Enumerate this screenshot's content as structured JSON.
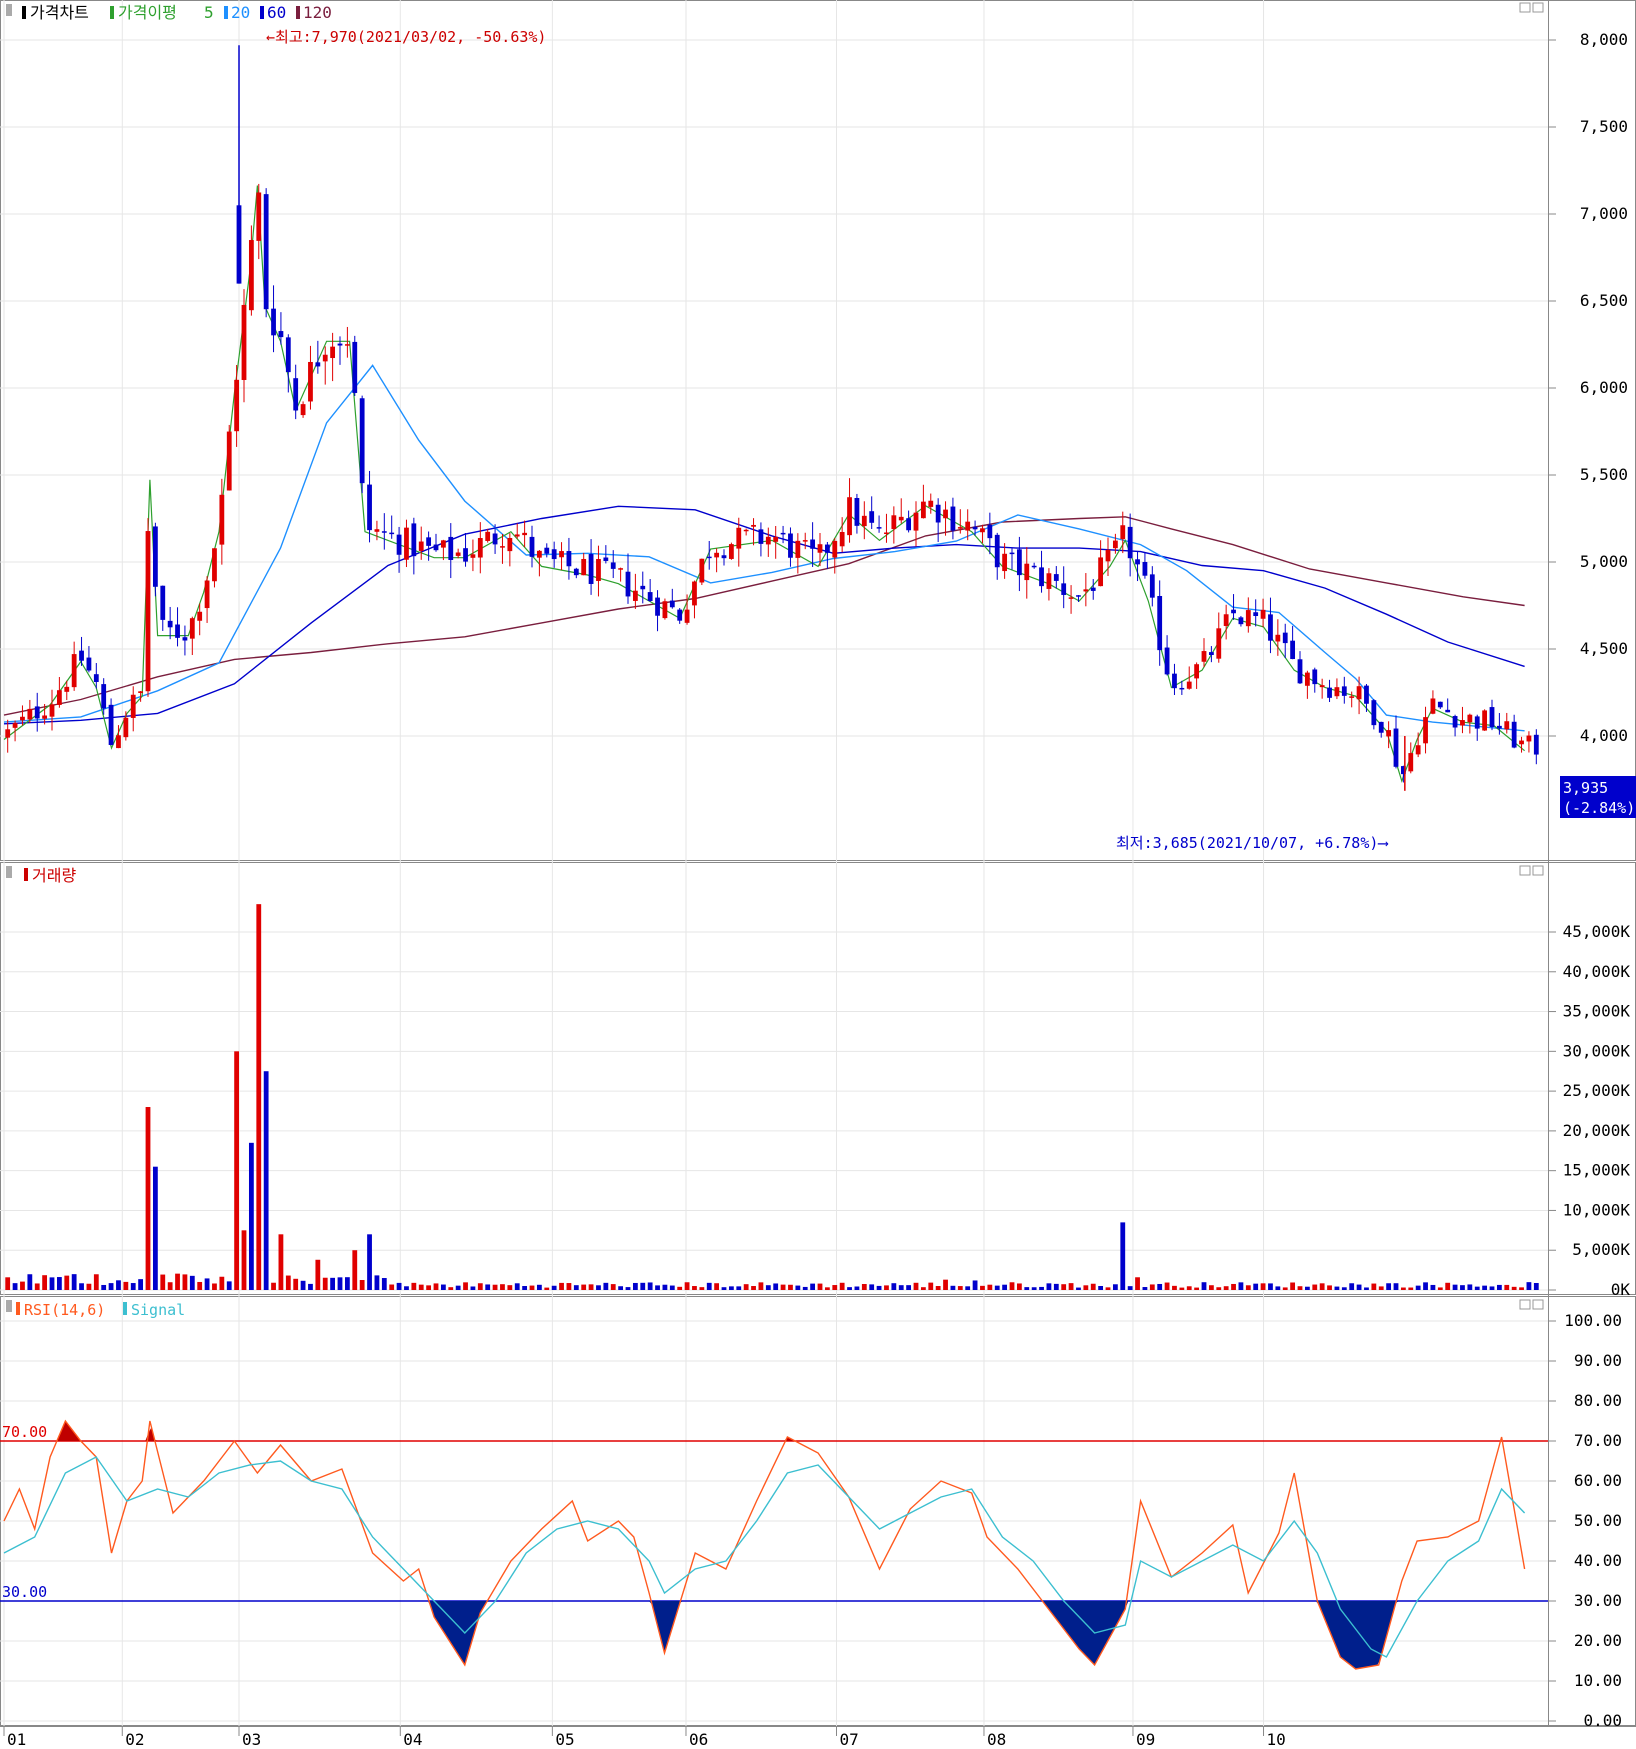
{
  "chart_data": [
    {
      "type": "candlestick",
      "panel": "price",
      "legend": [
        {
          "label": "가격차트",
          "color": "#000000"
        },
        {
          "label": "가격이평",
          "color": "#2ea02e"
        },
        {
          "label": "5",
          "color": "#2ea02e"
        },
        {
          "label": "20",
          "color": "#1e90ff"
        },
        {
          "label": "60",
          "color": "#0000cc"
        },
        {
          "label": "120",
          "color": "#7a1e3e"
        }
      ],
      "y_ticks": [
        "8,000",
        "7,500",
        "7,000",
        "6,500",
        "6,000",
        "5,500",
        "5,000",
        "4,500",
        "4,000"
      ],
      "ylim": [
        3550,
        8100
      ],
      "x_ticks": [
        "01",
        "02",
        "03",
        "04",
        "05",
        "06",
        "07",
        "08",
        "09",
        "10"
      ],
      "max_annotation": "←최고:7,970(2021/03/02, -50.63%)",
      "min_annotation": "최저:3,685(2021/10/07, +6.78%)⟶",
      "last_price": "3,935",
      "last_change": "(-2.84%)",
      "ma20_approx": [
        [
          0,
          4080
        ],
        [
          0.05,
          4110
        ],
        [
          0.1,
          4260
        ],
        [
          0.14,
          4420
        ],
        [
          0.18,
          5080
        ],
        [
          0.21,
          5800
        ],
        [
          0.24,
          6130
        ],
        [
          0.27,
          5700
        ],
        [
          0.3,
          5350
        ],
        [
          0.34,
          5040
        ],
        [
          0.38,
          5050
        ],
        [
          0.42,
          5030
        ],
        [
          0.46,
          4880
        ],
        [
          0.5,
          4940
        ],
        [
          0.54,
          5020
        ],
        [
          0.58,
          5060
        ],
        [
          0.62,
          5120
        ],
        [
          0.66,
          5270
        ],
        [
          0.7,
          5190
        ],
        [
          0.74,
          5100
        ],
        [
          0.77,
          4950
        ],
        [
          0.8,
          4740
        ],
        [
          0.83,
          4710
        ],
        [
          0.86,
          4480
        ],
        [
          0.88,
          4330
        ],
        [
          0.9,
          4120
        ],
        [
          0.93,
          4080
        ],
        [
          0.99,
          4030
        ]
      ],
      "ma60_approx": [
        [
          0,
          4070
        ],
        [
          0.05,
          4090
        ],
        [
          0.1,
          4130
        ],
        [
          0.15,
          4300
        ],
        [
          0.2,
          4650
        ],
        [
          0.25,
          4980
        ],
        [
          0.3,
          5160
        ],
        [
          0.35,
          5250
        ],
        [
          0.4,
          5320
        ],
        [
          0.45,
          5300
        ],
        [
          0.5,
          5150
        ],
        [
          0.54,
          5050
        ],
        [
          0.58,
          5080
        ],
        [
          0.62,
          5100
        ],
        [
          0.66,
          5080
        ],
        [
          0.7,
          5080
        ],
        [
          0.74,
          5060
        ],
        [
          0.78,
          4980
        ],
        [
          0.82,
          4950
        ],
        [
          0.86,
          4850
        ],
        [
          0.9,
          4700
        ],
        [
          0.94,
          4540
        ],
        [
          0.99,
          4400
        ]
      ],
      "ma120_approx": [
        [
          0,
          4120
        ],
        [
          0.05,
          4210
        ],
        [
          0.1,
          4340
        ],
        [
          0.15,
          4440
        ],
        [
          0.2,
          4480
        ],
        [
          0.25,
          4530
        ],
        [
          0.3,
          4570
        ],
        [
          0.35,
          4650
        ],
        [
          0.4,
          4730
        ],
        [
          0.45,
          4790
        ],
        [
          0.5,
          4890
        ],
        [
          0.55,
          4990
        ],
        [
          0.6,
          5150
        ],
        [
          0.65,
          5230
        ],
        [
          0.7,
          5250
        ],
        [
          0.73,
          5260
        ],
        [
          0.76,
          5190
        ],
        [
          0.8,
          5100
        ],
        [
          0.85,
          4960
        ],
        [
          0.9,
          4880
        ],
        [
          0.95,
          4800
        ],
        [
          0.99,
          4750
        ]
      ]
    },
    {
      "type": "bar",
      "panel": "volume",
      "legend": [
        {
          "label": "거래량",
          "color": "#cc0000"
        }
      ],
      "y_ticks": [
        "45,000K",
        "40,000K",
        "35,000K",
        "30,000K",
        "25,000K",
        "20,000K",
        "15,000K",
        "10,000K",
        "5,000K",
        "0K"
      ],
      "ylim": [
        0,
        50000
      ],
      "unit": "K",
      "spikes": [
        [
          0.095,
          23000
        ],
        [
          0.1,
          15500
        ],
        [
          0.15,
          30000
        ],
        [
          0.155,
          7500
        ],
        [
          0.16,
          18500
        ],
        [
          0.165,
          48500
        ],
        [
          0.17,
          27500
        ],
        [
          0.18,
          7000
        ],
        [
          0.205,
          3800
        ],
        [
          0.23,
          5000
        ],
        [
          0.24,
          7000
        ],
        [
          0.73,
          8500
        ],
        [
          0.74,
          1600
        ],
        [
          0.615,
          1300
        ],
        [
          0.63,
          1200
        ]
      ]
    },
    {
      "type": "line",
      "panel": "rsi",
      "legend": [
        {
          "label": "RSI(14,6)",
          "color": "#ff5a1f"
        },
        {
          "label": "Signal",
          "color": "#3cbfd0"
        }
      ],
      "y_ticks": [
        "100.00",
        "90.00",
        "80.00",
        "70.00",
        "60.00",
        "50.00",
        "40.00",
        "30.00",
        "20.00",
        "10.00",
        "0.00"
      ],
      "ylim": [
        0,
        100
      ],
      "upper_level": "70.00",
      "lower_level": "30.00",
      "rsi_approx": [
        [
          0,
          50
        ],
        [
          0.01,
          58
        ],
        [
          0.02,
          48
        ],
        [
          0.03,
          66
        ],
        [
          0.04,
          75
        ],
        [
          0.05,
          70
        ],
        [
          0.06,
          66
        ],
        [
          0.07,
          42
        ],
        [
          0.08,
          55
        ],
        [
          0.09,
          60
        ],
        [
          0.095,
          75
        ],
        [
          0.11,
          52
        ],
        [
          0.13,
          60
        ],
        [
          0.15,
          70
        ],
        [
          0.165,
          62
        ],
        [
          0.18,
          69
        ],
        [
          0.2,
          60
        ],
        [
          0.22,
          63
        ],
        [
          0.24,
          42
        ],
        [
          0.26,
          35
        ],
        [
          0.27,
          38
        ],
        [
          0.28,
          26
        ],
        [
          0.3,
          14
        ],
        [
          0.31,
          27
        ],
        [
          0.33,
          40
        ],
        [
          0.35,
          48
        ],
        [
          0.37,
          55
        ],
        [
          0.38,
          45
        ],
        [
          0.4,
          50
        ],
        [
          0.41,
          46
        ],
        [
          0.42,
          32
        ],
        [
          0.43,
          17
        ],
        [
          0.45,
          42
        ],
        [
          0.47,
          38
        ],
        [
          0.49,
          55
        ],
        [
          0.51,
          71
        ],
        [
          0.53,
          67
        ],
        [
          0.55,
          56
        ],
        [
          0.57,
          38
        ],
        [
          0.59,
          53
        ],
        [
          0.61,
          60
        ],
        [
          0.63,
          57
        ],
        [
          0.64,
          46
        ],
        [
          0.66,
          38
        ],
        [
          0.68,
          28
        ],
        [
          0.7,
          18
        ],
        [
          0.71,
          14
        ],
        [
          0.73,
          28
        ],
        [
          0.74,
          55
        ],
        [
          0.76,
          36
        ],
        [
          0.78,
          42
        ],
        [
          0.8,
          49
        ],
        [
          0.81,
          32
        ],
        [
          0.83,
          47
        ],
        [
          0.84,
          62
        ],
        [
          0.855,
          30
        ],
        [
          0.87,
          16
        ],
        [
          0.88,
          13
        ],
        [
          0.895,
          14
        ],
        [
          0.91,
          35
        ],
        [
          0.92,
          45
        ],
        [
          0.94,
          46
        ],
        [
          0.96,
          50
        ],
        [
          0.975,
          71
        ],
        [
          0.99,
          38
        ]
      ],
      "signal_approx": [
        [
          0,
          42
        ],
        [
          0.02,
          46
        ],
        [
          0.04,
          62
        ],
        [
          0.06,
          66
        ],
        [
          0.08,
          55
        ],
        [
          0.1,
          58
        ],
        [
          0.12,
          56
        ],
        [
          0.14,
          62
        ],
        [
          0.16,
          64
        ],
        [
          0.18,
          65
        ],
        [
          0.2,
          60
        ],
        [
          0.22,
          58
        ],
        [
          0.24,
          46
        ],
        [
          0.26,
          38
        ],
        [
          0.28,
          30
        ],
        [
          0.3,
          22
        ],
        [
          0.32,
          30
        ],
        [
          0.34,
          42
        ],
        [
          0.36,
          48
        ],
        [
          0.38,
          50
        ],
        [
          0.4,
          48
        ],
        [
          0.42,
          40
        ],
        [
          0.43,
          32
        ],
        [
          0.45,
          38
        ],
        [
          0.47,
          40
        ],
        [
          0.49,
          50
        ],
        [
          0.51,
          62
        ],
        [
          0.53,
          64
        ],
        [
          0.55,
          56
        ],
        [
          0.57,
          48
        ],
        [
          0.59,
          52
        ],
        [
          0.61,
          56
        ],
        [
          0.63,
          58
        ],
        [
          0.65,
          46
        ],
        [
          0.67,
          40
        ],
        [
          0.69,
          30
        ],
        [
          0.71,
          22
        ],
        [
          0.73,
          24
        ],
        [
          0.74,
          40
        ],
        [
          0.76,
          36
        ],
        [
          0.78,
          40
        ],
        [
          0.8,
          44
        ],
        [
          0.82,
          40
        ],
        [
          0.84,
          50
        ],
        [
          0.855,
          42
        ],
        [
          0.87,
          28
        ],
        [
          0.89,
          18
        ],
        [
          0.9,
          16
        ],
        [
          0.92,
          30
        ],
        [
          0.94,
          40
        ],
        [
          0.96,
          45
        ],
        [
          0.975,
          58
        ],
        [
          0.99,
          52
        ]
      ]
    }
  ]
}
